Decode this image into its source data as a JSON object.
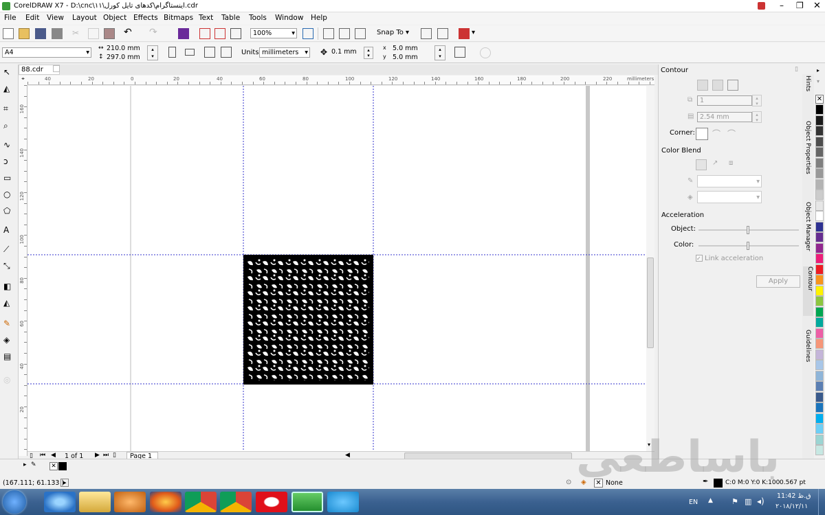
{
  "window": {
    "title": "CorelDRAW X7 - D:\\cnc\\۱۱\\اینستاگرام\\کدهای تایل کورل.cdr"
  },
  "menu": [
    "File",
    "Edit",
    "View",
    "Layout",
    "Object",
    "Effects",
    "Bitmaps",
    "Text",
    "Table",
    "Tools",
    "Window",
    "Help"
  ],
  "standard_toolbar": {
    "zoom": "100%",
    "snap_to": "Snap To"
  },
  "property_bar": {
    "paper": "A4",
    "width": "210.0 mm",
    "height": "297.0 mm",
    "units_label": "Units:",
    "units": "millimeters",
    "nudge": "0.1 mm",
    "dup_x": "5.0 mm",
    "dup_y": "5.0 mm"
  },
  "document": {
    "tab": "88.cdr",
    "ruler_unit": "millimeters",
    "page_count": "1 of 1",
    "page_tab": "Page 1"
  },
  "ruler": {
    "h_labels": [
      "40",
      "20",
      "0",
      "20",
      "40",
      "60",
      "80",
      "100",
      "120",
      "140",
      "160",
      "180",
      "200",
      "220"
    ],
    "v_labels": [
      "160",
      "140",
      "120",
      "100",
      "80",
      "60",
      "40",
      "20"
    ]
  },
  "docker": {
    "title": "Contour",
    "steps": "1",
    "offset": "2.54 mm",
    "corner_label": "Corner:",
    "color_blend_label": "Color Blend",
    "acceleration_label": "Acceleration",
    "object_label": "Object:",
    "color_label": "Color:",
    "link_acceleration": "Link acceleration",
    "apply": "Apply",
    "side_tabs": [
      "Hints",
      "Object Properties",
      "Object Manager",
      "Contour",
      "Guidelines"
    ]
  },
  "palette": [
    "#ffffff",
    "#000000",
    "#1a1a1a",
    "#333333",
    "#4d4d4d",
    "#666666",
    "#808080",
    "#999999",
    "#b3b3b3",
    "#cccccc",
    "#e6e6e6",
    "#ffffff",
    "#2e3192",
    "#662d91",
    "#92278f",
    "#ed1e79",
    "#ed1c24",
    "#f7941d",
    "#fff200",
    "#8dc63f",
    "#00a651",
    "#00a99d",
    "#ed5fa6",
    "#f69679",
    "#c4b5d9",
    "#a8c6e8",
    "#8fb5d9",
    "#5b7fb3",
    "#3a5a8c",
    "#1b75bc",
    "#00aeef",
    "#6dcff6",
    "#9bd5d3",
    "#c7e8e3"
  ],
  "status": {
    "coords": "(167.111; 61.133 )",
    "fill": "None",
    "outline": "C:0 M:0 Y:0 K:100",
    "outline_width": "0.567 pt"
  },
  "watermark": "باساطعی",
  "taskbar": {
    "lang": "EN",
    "time": "11:42 ق.ظ",
    "date": "۲۰۱۸/۱۲/۱۱"
  }
}
